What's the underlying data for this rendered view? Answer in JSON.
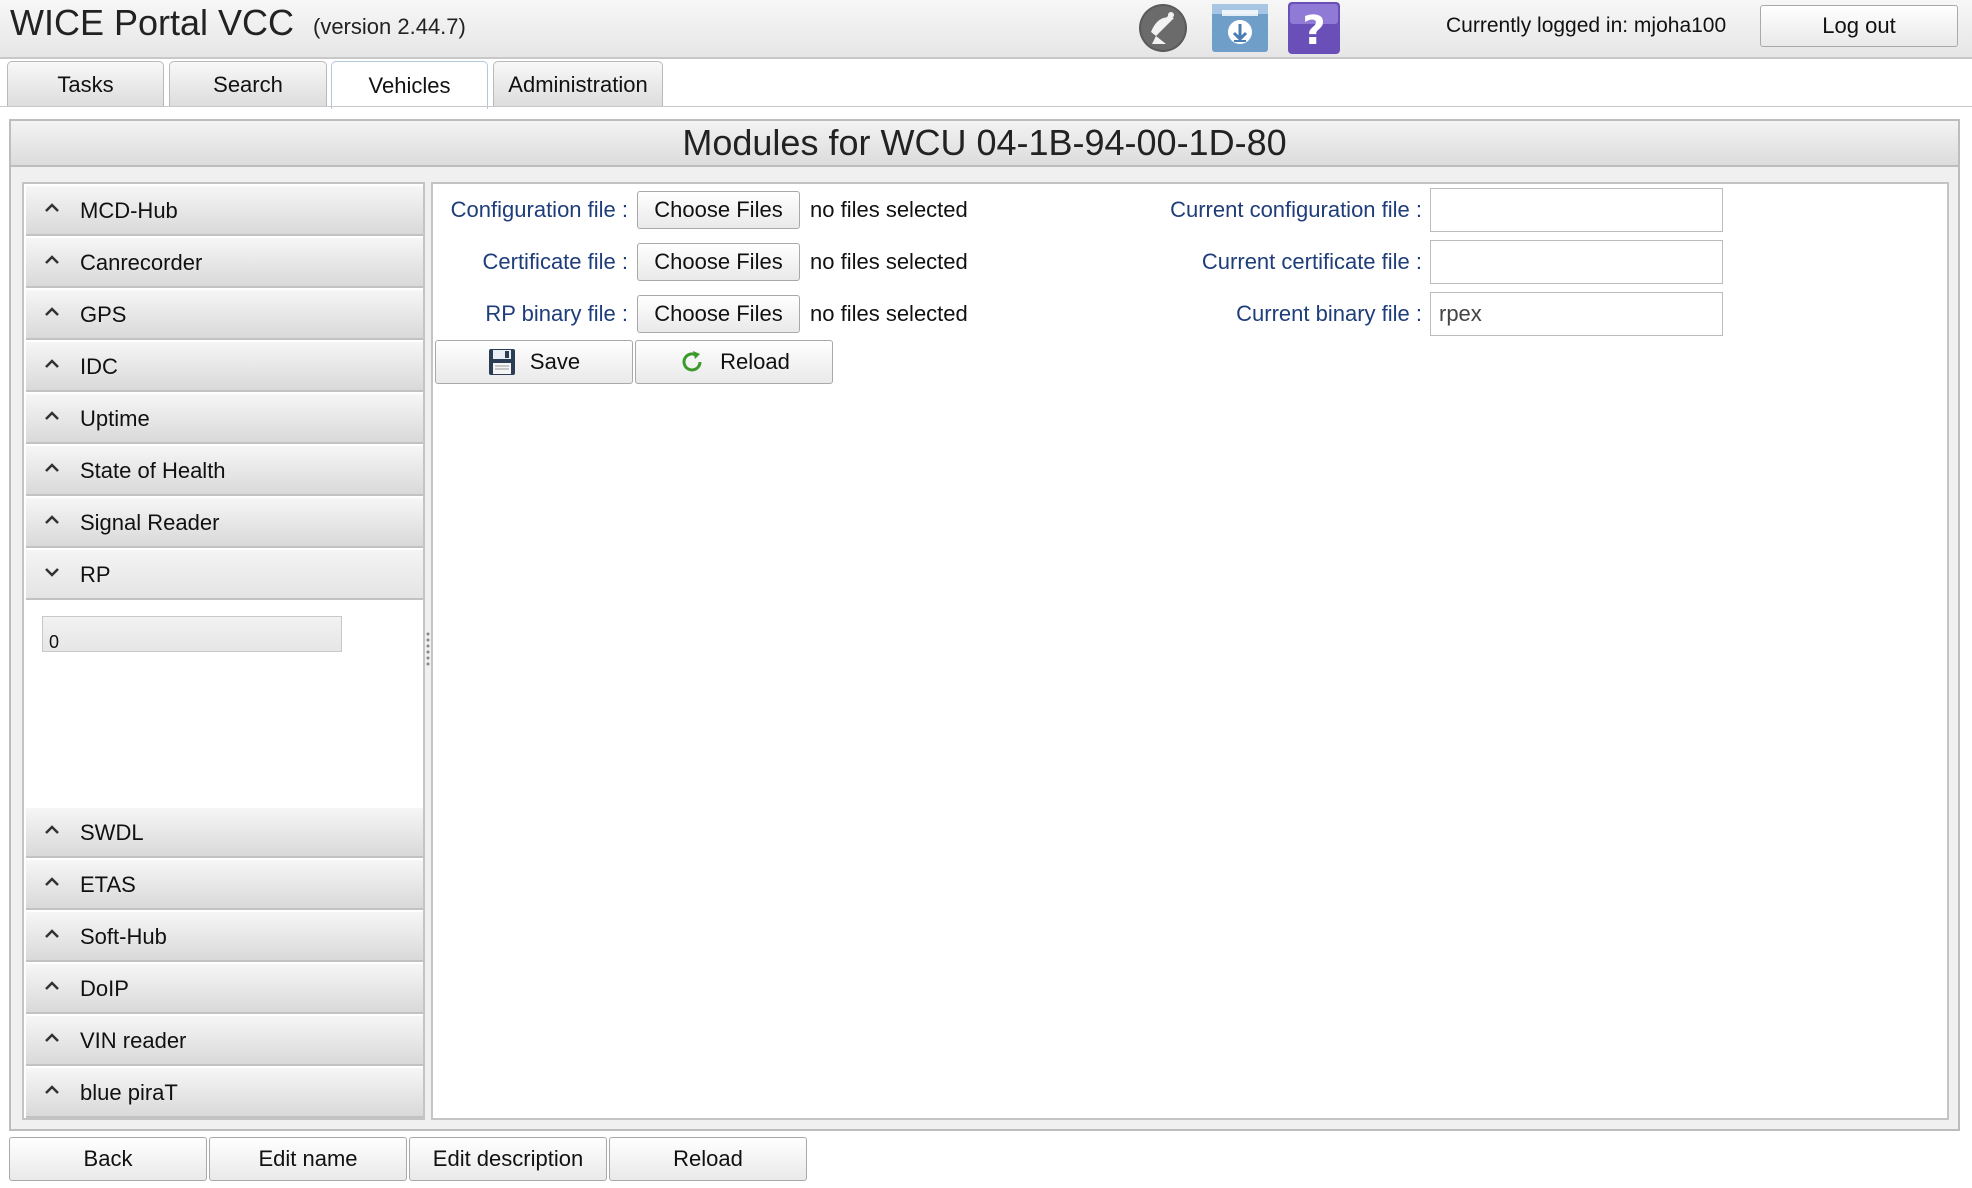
{
  "header": {
    "app_title": "WICE Portal VCC",
    "version": "(version 2.44.7)",
    "icons": [
      "satellite-dish-icon",
      "download-icon",
      "help-icon"
    ],
    "logged_in": "Currently logged in: mjoha100",
    "logout_label": "Log out"
  },
  "tabs": [
    {
      "label": "Tasks"
    },
    {
      "label": "Search"
    },
    {
      "label": "Vehicles",
      "active": true
    },
    {
      "label": "Administration"
    }
  ],
  "page_title": "Modules for WCU 04-1B-94-00-1D-80",
  "modules": [
    {
      "label": "MCD-Hub"
    },
    {
      "label": "Canrecorder"
    },
    {
      "label": "GPS"
    },
    {
      "label": "IDC"
    },
    {
      "label": "Uptime"
    },
    {
      "label": "State of Health"
    },
    {
      "label": "Signal Reader"
    },
    {
      "label": "RP",
      "expanded": true
    },
    {
      "label": "SWDL"
    },
    {
      "label": "ETAS"
    },
    {
      "label": "Soft-Hub"
    },
    {
      "label": "DoIP"
    },
    {
      "label": "VIN reader"
    },
    {
      "label": "blue piraT"
    }
  ],
  "rp_panel": {
    "list_value": "0"
  },
  "form": {
    "config_label": "Configuration file :",
    "cert_label": "Certificate file :",
    "binary_label": "RP binary file :",
    "choose_files": "Choose Files",
    "no_files": "no files selected",
    "current_config_label": "Current configuration file :",
    "current_cert_label": "Current certificate file :",
    "current_binary_label": "Current binary file :",
    "current_config_value": "",
    "current_cert_value": "",
    "current_binary_value": "rpex",
    "save_label": "Save",
    "reload_label": "Reload"
  },
  "footer": {
    "back": "Back",
    "edit_name": "Edit name",
    "edit_description": "Edit description",
    "reload": "Reload"
  },
  "colors": {
    "form_label": "#1e3d7a",
    "reload_icon": "#3a9a2a"
  }
}
